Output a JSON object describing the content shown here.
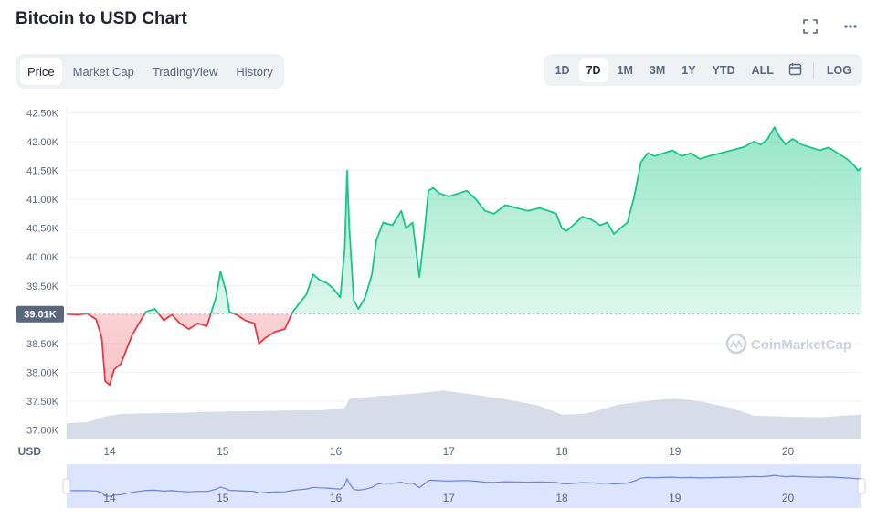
{
  "title": "Bitcoin to USD Chart",
  "tabs": [
    "Price",
    "Market Cap",
    "TradingView",
    "History"
  ],
  "ranges": [
    "1D",
    "7D",
    "1M",
    "3M",
    "1Y",
    "YTD",
    "ALL"
  ],
  "log_label": "LOG",
  "currency_label": "USD",
  "watermark": "CoinMarketCap",
  "colors": {
    "up": "#16c784",
    "down": "#ea3943",
    "volume": "#cfd6e4",
    "nav": "#dde4ff"
  },
  "chart_data": {
    "type": "line",
    "current_label": "39.01K",
    "reference_price": 39010,
    "ylim": [
      36850,
      42650
    ],
    "yticks": [
      {
        "v": 42500,
        "label": "42.50K"
      },
      {
        "v": 42000,
        "label": "42.00K"
      },
      {
        "v": 41500,
        "label": "41.50K"
      },
      {
        "v": 41000,
        "label": "41.00K"
      },
      {
        "v": 40500,
        "label": "40.50K"
      },
      {
        "v": 40000,
        "label": "40.00K"
      },
      {
        "v": 39500,
        "label": "39.50K"
      },
      {
        "v": 38500,
        "label": "38.50K"
      },
      {
        "v": 38000,
        "label": "38.00K"
      },
      {
        "v": 37500,
        "label": "37.50K"
      },
      {
        "v": 37000,
        "label": "37.00K"
      }
    ],
    "xlim": [
      13.62,
      20.65
    ],
    "xticks": [
      {
        "v": 14,
        "label": "14"
      },
      {
        "v": 15,
        "label": "15"
      },
      {
        "v": 16,
        "label": "16"
      },
      {
        "v": 17,
        "label": "17"
      },
      {
        "v": 18,
        "label": "18"
      },
      {
        "v": 19,
        "label": "19"
      },
      {
        "v": 20,
        "label": "20"
      }
    ],
    "price": [
      [
        13.62,
        39010
      ],
      [
        13.72,
        39000
      ],
      [
        13.8,
        39020
      ],
      [
        13.88,
        38920
      ],
      [
        13.93,
        38600
      ],
      [
        13.96,
        37850
      ],
      [
        14.0,
        37780
      ],
      [
        14.04,
        38050
      ],
      [
        14.1,
        38150
      ],
      [
        14.16,
        38450
      ],
      [
        14.2,
        38650
      ],
      [
        14.26,
        38850
      ],
      [
        14.32,
        39050
      ],
      [
        14.4,
        39100
      ],
      [
        14.48,
        38900
      ],
      [
        14.55,
        39000
      ],
      [
        14.62,
        38850
      ],
      [
        14.7,
        38750
      ],
      [
        14.78,
        38850
      ],
      [
        14.86,
        38800
      ],
      [
        14.94,
        39300
      ],
      [
        14.98,
        39750
      ],
      [
        15.03,
        39400
      ],
      [
        15.06,
        39050
      ],
      [
        15.12,
        39000
      ],
      [
        15.2,
        38900
      ],
      [
        15.28,
        38850
      ],
      [
        15.32,
        38500
      ],
      [
        15.38,
        38600
      ],
      [
        15.46,
        38700
      ],
      [
        15.55,
        38750
      ],
      [
        15.62,
        39050
      ],
      [
        15.68,
        39200
      ],
      [
        15.74,
        39350
      ],
      [
        15.8,
        39700
      ],
      [
        15.86,
        39600
      ],
      [
        15.92,
        39550
      ],
      [
        15.98,
        39450
      ],
      [
        16.04,
        39300
      ],
      [
        16.08,
        40150
      ],
      [
        16.1,
        41500
      ],
      [
        16.12,
        40500
      ],
      [
        16.16,
        39250
      ],
      [
        16.2,
        39100
      ],
      [
        16.26,
        39300
      ],
      [
        16.32,
        39700
      ],
      [
        16.36,
        40300
      ],
      [
        16.42,
        40600
      ],
      [
        16.5,
        40550
      ],
      [
        16.58,
        40800
      ],
      [
        16.62,
        40500
      ],
      [
        16.68,
        40600
      ],
      [
        16.74,
        39650
      ],
      [
        16.78,
        40350
      ],
      [
        16.82,
        41150
      ],
      [
        16.86,
        41200
      ],
      [
        16.92,
        41100
      ],
      [
        17.0,
        41050
      ],
      [
        17.08,
        41100
      ],
      [
        17.16,
        41150
      ],
      [
        17.24,
        41000
      ],
      [
        17.32,
        40800
      ],
      [
        17.4,
        40750
      ],
      [
        17.5,
        40900
      ],
      [
        17.6,
        40850
      ],
      [
        17.7,
        40800
      ],
      [
        17.8,
        40850
      ],
      [
        17.88,
        40800
      ],
      [
        17.95,
        40750
      ],
      [
        18.0,
        40500
      ],
      [
        18.04,
        40450
      ],
      [
        18.1,
        40550
      ],
      [
        18.18,
        40700
      ],
      [
        18.26,
        40650
      ],
      [
        18.34,
        40550
      ],
      [
        18.4,
        40600
      ],
      [
        18.46,
        40400
      ],
      [
        18.52,
        40500
      ],
      [
        18.58,
        40600
      ],
      [
        18.64,
        41050
      ],
      [
        18.7,
        41650
      ],
      [
        18.76,
        41800
      ],
      [
        18.82,
        41750
      ],
      [
        18.9,
        41800
      ],
      [
        18.98,
        41850
      ],
      [
        19.06,
        41750
      ],
      [
        19.14,
        41800
      ],
      [
        19.22,
        41700
      ],
      [
        19.3,
        41750
      ],
      [
        19.4,
        41800
      ],
      [
        19.5,
        41850
      ],
      [
        19.6,
        41900
      ],
      [
        19.7,
        42000
      ],
      [
        19.76,
        41950
      ],
      [
        19.82,
        42050
      ],
      [
        19.88,
        42250
      ],
      [
        19.92,
        42100
      ],
      [
        19.98,
        41950
      ],
      [
        20.04,
        42050
      ],
      [
        20.12,
        41950
      ],
      [
        20.2,
        41900
      ],
      [
        20.28,
        41850
      ],
      [
        20.36,
        41900
      ],
      [
        20.44,
        41800
      ],
      [
        20.52,
        41700
      ],
      [
        20.58,
        41600
      ],
      [
        20.62,
        41500
      ],
      [
        20.65,
        41550
      ]
    ],
    "volume_level": [
      [
        13.62,
        0.28
      ],
      [
        13.8,
        0.3
      ],
      [
        13.95,
        0.4
      ],
      [
        14.1,
        0.45
      ],
      [
        14.3,
        0.46
      ],
      [
        14.6,
        0.47
      ],
      [
        14.9,
        0.49
      ],
      [
        15.2,
        0.5
      ],
      [
        15.5,
        0.51
      ],
      [
        15.9,
        0.52
      ],
      [
        16.08,
        0.56
      ],
      [
        16.12,
        0.73
      ],
      [
        16.4,
        0.78
      ],
      [
        16.7,
        0.82
      ],
      [
        16.95,
        0.88
      ],
      [
        17.2,
        0.81
      ],
      [
        17.5,
        0.72
      ],
      [
        17.8,
        0.6
      ],
      [
        18.0,
        0.44
      ],
      [
        18.2,
        0.45
      ],
      [
        18.5,
        0.62
      ],
      [
        18.8,
        0.7
      ],
      [
        19.0,
        0.73
      ],
      [
        19.2,
        0.69
      ],
      [
        19.5,
        0.56
      ],
      [
        19.7,
        0.42
      ],
      [
        20.0,
        0.4
      ],
      [
        20.3,
        0.39
      ],
      [
        20.55,
        0.43
      ],
      [
        20.65,
        0.44
      ]
    ]
  }
}
